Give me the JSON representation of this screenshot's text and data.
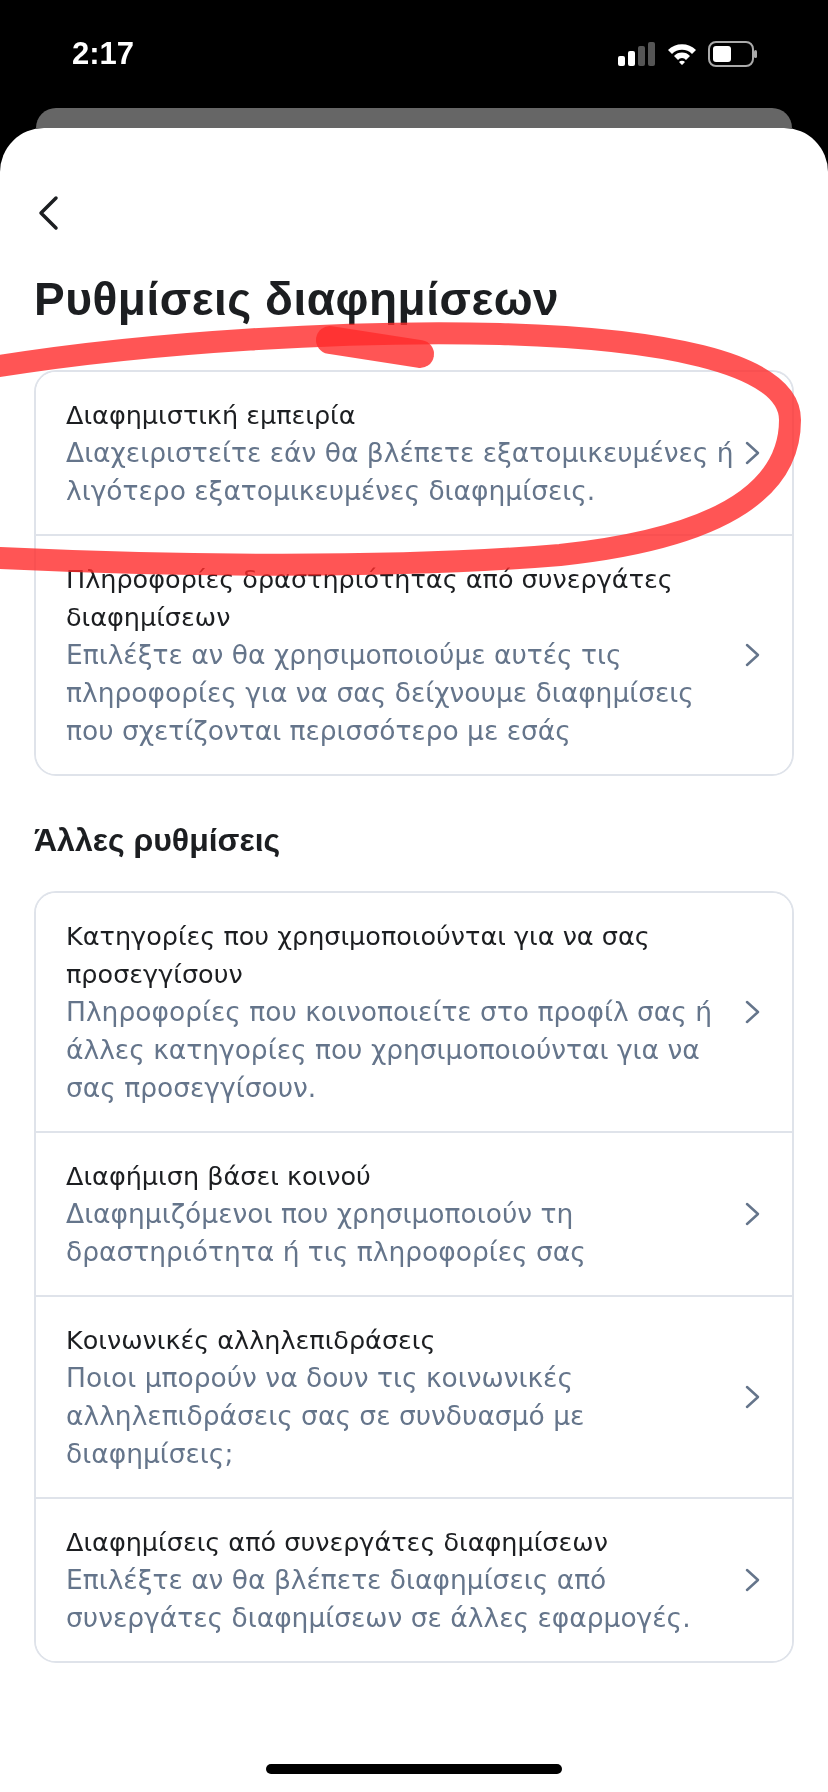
{
  "status_bar": {
    "time": "2:17"
  },
  "title": "Ρυθμίσεις διαφημίσεων",
  "groups": [
    {
      "items": [
        {
          "title": "Διαφημιστική εμπειρία",
          "description": "Διαχειριστείτε εάν θα βλέπετε εξατομικευμένες ή λιγότερο εξατομικευμένες διαφημίσεις."
        },
        {
          "title": "Πληροφορίες δραστηριότητας από συνεργάτες διαφημίσεων",
          "description": "Επιλέξτε αν θα χρησιμοποιούμε αυτές τις πληροφορίες για να σας δείχνουμε διαφημίσεις που σχετίζονται περισσότερο με εσάς"
        }
      ]
    },
    {
      "heading": "Άλλες ρυθμίσεις",
      "items": [
        {
          "title": "Κατηγορίες που χρησιμοποιούνται για να σας προσεγγίσουν",
          "description": "Πληροφορίες που κοινοποιείτε στο προφίλ σας ή άλλες κατηγορίες που χρησιμοποιούνται για να σας προσεγγίσουν."
        },
        {
          "title": "Διαφήμιση βάσει κοινού",
          "description": "Διαφημιζόμενοι που χρησιμοποιούν τη δραστηριότητα ή τις πληροφορίες σας"
        },
        {
          "title": "Κοινωνικές αλληλεπιδράσεις",
          "description": "Ποιοι μπορούν να δουν τις κοινωνικές αλληλεπιδράσεις σας σε συνδυασμό με διαφημίσεις;"
        },
        {
          "title": "Διαφημίσεις από συνεργάτες διαφημίσεων",
          "description": "Επιλέξτε αν θα βλέπετε διαφημίσεις από συνεργάτες διαφημίσεων σε άλλες εφαρμογές."
        }
      ]
    }
  ]
}
